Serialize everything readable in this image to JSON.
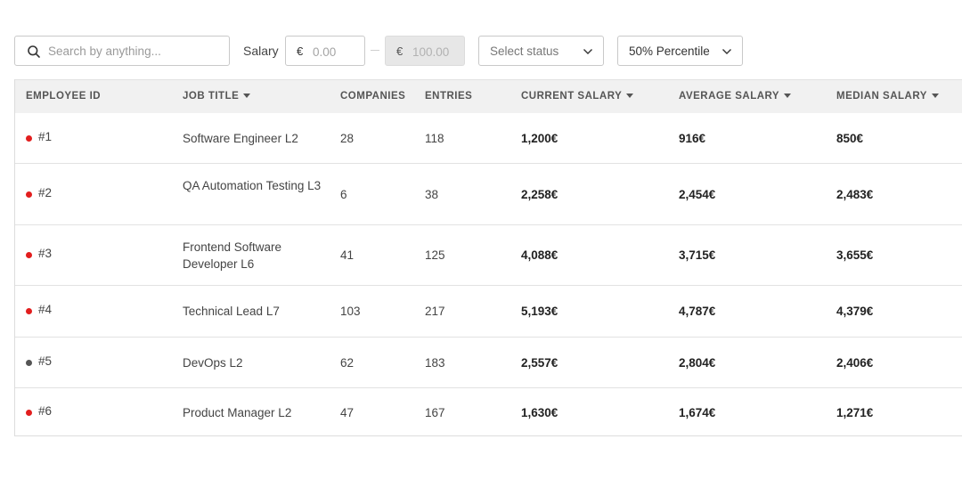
{
  "filters": {
    "search_placeholder": "Search by anything...",
    "salary_label": "Salary",
    "currency_symbol": "€",
    "salary_min_placeholder": "0.00",
    "salary_max_placeholder": "100.00",
    "status_label": "Select status",
    "percentile_label": "50% Percentile"
  },
  "table": {
    "headers": {
      "employee_id": "EMPLOYEE ID",
      "job_title": "JOB TITLE",
      "companies": "COMPANIES",
      "entries": "ENTRIES",
      "current_salary": "CURRENT SALARY",
      "average_salary": "AVERAGE SALARY",
      "median_salary": "MEDIAN SALARY"
    },
    "rows": [
      {
        "id": "#1",
        "job_title": "Software Engineer L2",
        "companies": "28",
        "entries": "118",
        "current_salary": "1,200€",
        "average_salary": "916€",
        "median_salary": "850€",
        "status_color": "#e21e1e"
      },
      {
        "id": "#2",
        "job_title": "QA Automation Testing L3",
        "companies": "6",
        "entries": "38",
        "current_salary": "2,258€",
        "average_salary": "2,454€",
        "median_salary": "2,483€",
        "status_color": "#e21e1e"
      },
      {
        "id": "#3",
        "job_title": "Frontend Software Developer L6",
        "companies": "41",
        "entries": "125",
        "current_salary": "4,088€",
        "average_salary": "3,715€",
        "median_salary": "3,655€",
        "status_color": "#e21e1e"
      },
      {
        "id": "#4",
        "job_title": "Technical Lead L7",
        "companies": "103",
        "entries": "217",
        "current_salary": "5,193€",
        "average_salary": "4,787€",
        "median_salary": "4,379€",
        "status_color": "#e21e1e"
      },
      {
        "id": "#5",
        "job_title": "DevOps L2",
        "companies": "62",
        "entries": "183",
        "current_salary": "2,557€",
        "average_salary": "2,804€",
        "median_salary": "2,406€",
        "status_color": "#555555"
      },
      {
        "id": "#6",
        "job_title": "Product Manager L2",
        "companies": "47",
        "entries": "167",
        "current_salary": "1,630€",
        "average_salary": "1,674€",
        "median_salary": "1,271€",
        "status_color": "#e21e1e"
      }
    ]
  }
}
